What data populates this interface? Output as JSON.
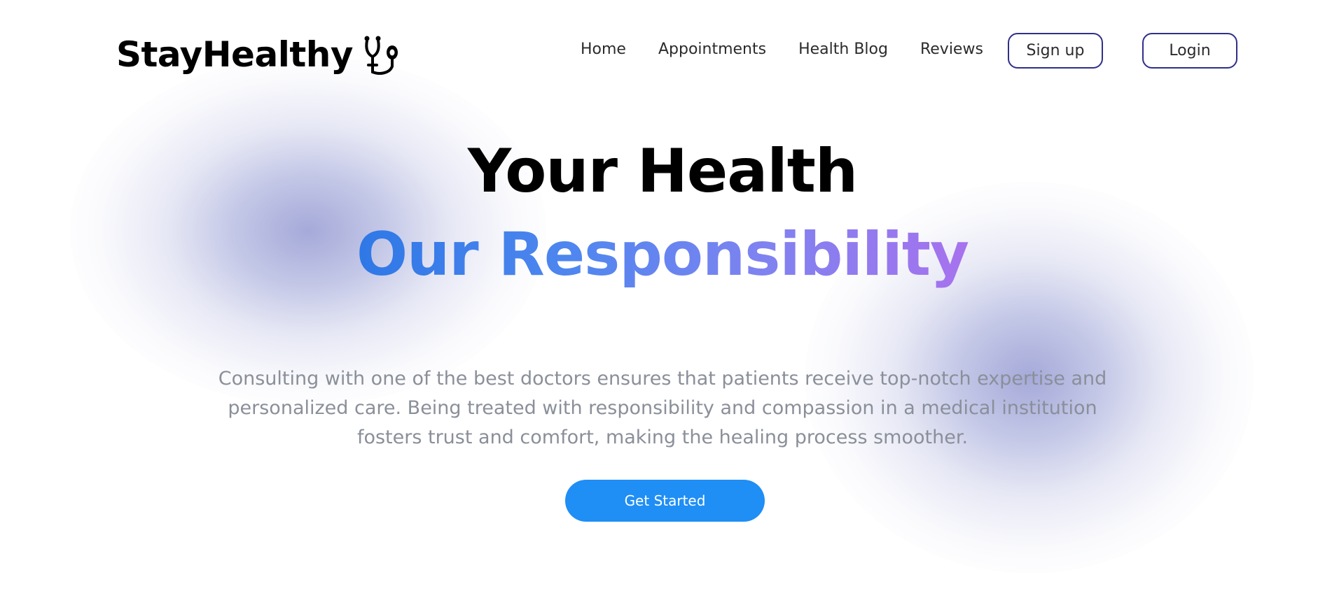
{
  "brand": {
    "name": "StayHealthy",
    "logo_icon": "stethoscope-icon"
  },
  "nav": {
    "items": [
      {
        "label": "Home"
      },
      {
        "label": "Appointments"
      },
      {
        "label": "Health Blog"
      },
      {
        "label": "Reviews"
      }
    ],
    "signup_label": "Sign up",
    "login_label": "Login"
  },
  "hero": {
    "title_line1": "Your Health",
    "title_line2": "Our Responsibility",
    "description": "Consulting with one of the best doctors ensures that patients receive top-notch expertise and personalized care. Being treated with responsibility and compassion in a medical institution fosters trust and comfort, making the healing process smoother.",
    "cta_label": "Get Started"
  },
  "colors": {
    "primary_button": "#1f8ef5",
    "outline_border": "#2f2f8a",
    "gradient_start": "#2e78e6",
    "gradient_end": "#a772ee",
    "body_text": "#8a8f99",
    "blob": "#a0a5d7"
  }
}
